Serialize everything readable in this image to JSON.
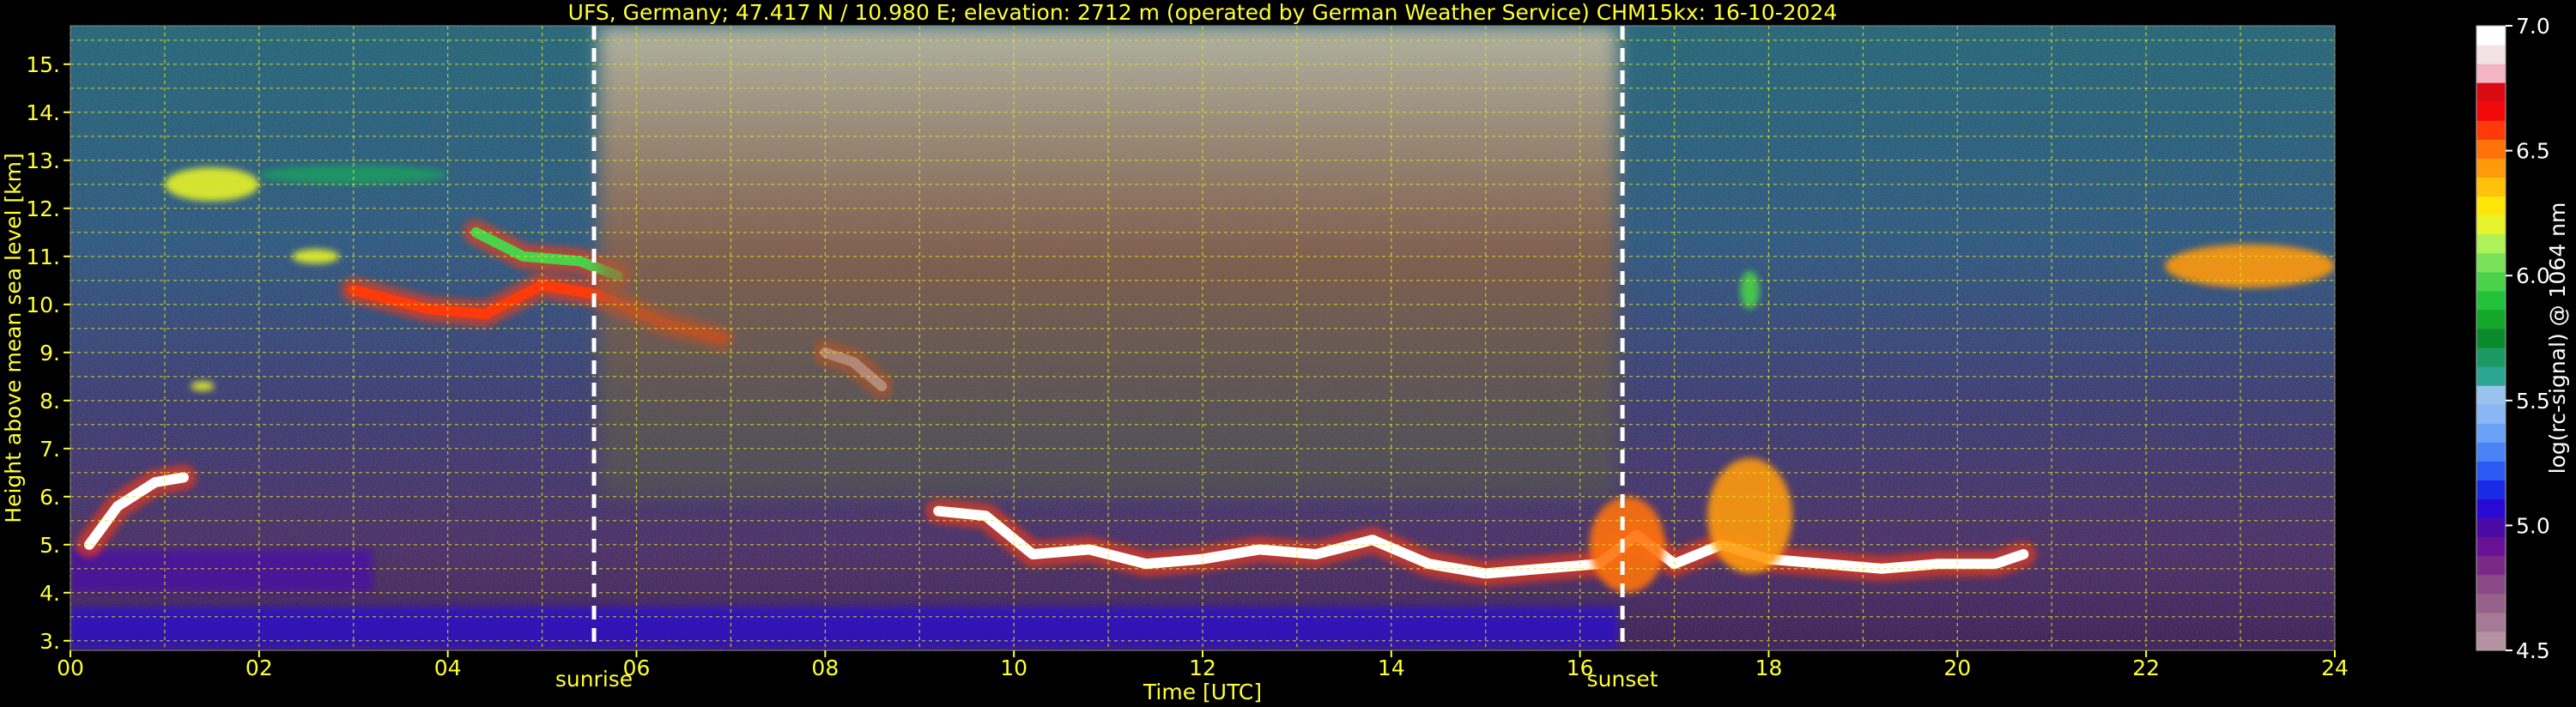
{
  "chart_data": {
    "type": "heatmap",
    "title": "UFS, Germany; 47.417 N / 10.980 E; elevation: 2712 m  (operated by German Weather Service)     CHM15kx: 16-10-2024",
    "xlabel": "Time [UTC]",
    "ylabel": "Height above mean sea level [km]",
    "xlim": [
      0,
      24
    ],
    "ylim": [
      2.8,
      15.8
    ],
    "x_ticks": [
      {
        "v": 0,
        "label": "00"
      },
      {
        "v": 2,
        "label": "02"
      },
      {
        "v": 4,
        "label": "04"
      },
      {
        "v": 6,
        "label": "06"
      },
      {
        "v": 8,
        "label": "08"
      },
      {
        "v": 10,
        "label": "10"
      },
      {
        "v": 12,
        "label": "12"
      },
      {
        "v": 14,
        "label": "14"
      },
      {
        "v": 16,
        "label": "16"
      },
      {
        "v": 18,
        "label": "18"
      },
      {
        "v": 20,
        "label": "20"
      },
      {
        "v": 22,
        "label": "22"
      },
      {
        "v": 24,
        "label": "24"
      }
    ],
    "y_ticks": [
      {
        "v": 3,
        "label": "3."
      },
      {
        "v": 4,
        "label": "4."
      },
      {
        "v": 5,
        "label": "5."
      },
      {
        "v": 6,
        "label": "6."
      },
      {
        "v": 7,
        "label": "7."
      },
      {
        "v": 8,
        "label": "8."
      },
      {
        "v": 9,
        "label": "9."
      },
      {
        "v": 10,
        "label": "10."
      },
      {
        "v": 11,
        "label": "11."
      },
      {
        "v": 12,
        "label": "12."
      },
      {
        "v": 13,
        "label": "13."
      },
      {
        "v": 14,
        "label": "14."
      },
      {
        "v": 15,
        "label": "15."
      }
    ],
    "x_minor_step": 1,
    "y_minor_step": 0.5,
    "grid": true,
    "events": [
      {
        "name": "sunrise",
        "x": 5.55
      },
      {
        "name": "sunset",
        "x": 16.45
      }
    ],
    "colorbar": {
      "label": "log(rc-signal) @ 1064 nm",
      "min": 4.5,
      "max": 7.0,
      "ticks": [
        {
          "v": 4.5,
          "label": "4.5"
        },
        {
          "v": 5.0,
          "label": "5.0"
        },
        {
          "v": 5.5,
          "label": "5.5"
        },
        {
          "v": 6.0,
          "label": "6.0"
        },
        {
          "v": 6.5,
          "label": "6.5"
        },
        {
          "v": 7.0,
          "label": "7.0"
        }
      ],
      "colors": [
        "#b592a2",
        "#a67a96",
        "#96628a",
        "#8a4a86",
        "#7a2a86",
        "#6a1296",
        "#4a0aa6",
        "#2a0ad2",
        "#1a2ae6",
        "#2a5af2",
        "#4a82f6",
        "#6aa2f6",
        "#8ab6f6",
        "#9ac2ee",
        "#2aa692",
        "#1a9a62",
        "#0a8a2a",
        "#12a62a",
        "#22c23a",
        "#4ad24a",
        "#7ae25a",
        "#aef25a",
        "#e6f22a",
        "#ffe60a",
        "#ffc20a",
        "#ff9a0a",
        "#ff720a",
        "#ff3a0a",
        "#f20a0a",
        "#da0a12",
        "#f2b6c2",
        "#f2e2e6",
        "#ffffff"
      ]
    },
    "features": [
      {
        "name": "boundary-layer-aerosol",
        "kind": "band",
        "x0": 0,
        "x1": 16.4,
        "y0": 2.85,
        "y1": 3.7,
        "value": 5.1
      },
      {
        "name": "pbl-upper-layer",
        "kind": "band",
        "x0": 0,
        "x1": 3.2,
        "y0": 4.0,
        "y1": 4.9,
        "value": 5.0
      },
      {
        "name": "morning-cloud-base",
        "kind": "line",
        "value": 7.0,
        "points": [
          [
            0.2,
            5.0
          ],
          [
            0.5,
            5.8
          ],
          [
            0.9,
            6.3
          ],
          [
            1.2,
            6.4
          ]
        ]
      },
      {
        "name": "cirrus-upper",
        "kind": "blob",
        "x": 1.5,
        "y": 12.5,
        "w": 1.0,
        "h": 0.7,
        "value": 6.2
      },
      {
        "name": "cirrus-upper-tail",
        "kind": "blob",
        "x": 3.0,
        "y": 12.7,
        "w": 2.0,
        "h": 0.4,
        "value": 5.7
      },
      {
        "name": "cirrus-mid",
        "kind": "blob",
        "x": 2.6,
        "y": 11.0,
        "w": 0.5,
        "h": 0.3,
        "value": 6.2
      },
      {
        "name": "cirrus-band-morning",
        "kind": "line",
        "value": 6.6,
        "points": [
          [
            3.0,
            10.3
          ],
          [
            3.8,
            9.9
          ],
          [
            4.4,
            9.8
          ],
          [
            5.0,
            10.4
          ],
          [
            5.6,
            10.2
          ],
          [
            6.3,
            9.6
          ],
          [
            6.9,
            9.3
          ]
        ]
      },
      {
        "name": "cirrus-band-morning-top",
        "kind": "line",
        "value": 6.0,
        "points": [
          [
            4.3,
            11.5
          ],
          [
            4.8,
            11.0
          ],
          [
            5.4,
            10.9
          ],
          [
            5.8,
            10.6
          ]
        ]
      },
      {
        "name": "cirrus-speck",
        "kind": "blob",
        "x": 1.4,
        "y": 8.3,
        "w": 0.25,
        "h": 0.2,
        "value": 6.2
      },
      {
        "name": "cirrus-fall",
        "kind": "line",
        "value": 6.8,
        "points": [
          [
            8.0,
            9.0
          ],
          [
            8.3,
            8.8
          ],
          [
            8.6,
            8.3
          ]
        ]
      },
      {
        "name": "cloud-base-day",
        "kind": "line",
        "value": 7.0,
        "points": [
          [
            9.2,
            5.7
          ],
          [
            9.7,
            5.6
          ],
          [
            10.2,
            4.8
          ],
          [
            10.8,
            4.9
          ],
          [
            11.4,
            4.6
          ],
          [
            12.0,
            4.7
          ],
          [
            12.6,
            4.9
          ],
          [
            13.2,
            4.8
          ],
          [
            13.8,
            5.1
          ],
          [
            14.4,
            4.6
          ],
          [
            15.0,
            4.4
          ],
          [
            15.6,
            4.5
          ],
          [
            16.2,
            4.6
          ],
          [
            16.6,
            5.2
          ],
          [
            17.0,
            4.6
          ],
          [
            17.5,
            5.0
          ],
          [
            18.0,
            4.7
          ],
          [
            18.6,
            4.6
          ],
          [
            19.2,
            4.5
          ],
          [
            19.8,
            4.6
          ],
          [
            20.4,
            4.6
          ],
          [
            20.7,
            4.8
          ]
        ]
      },
      {
        "name": "convective-cloud-evening",
        "kind": "blob",
        "x": 16.5,
        "y": 5.0,
        "w": 0.8,
        "h": 2.0,
        "value": 6.5
      },
      {
        "name": "convective-cloud-18",
        "kind": "blob",
        "x": 17.8,
        "y": 5.6,
        "w": 0.9,
        "h": 2.4,
        "value": 6.4
      },
      {
        "name": "virga-18",
        "kind": "blob",
        "x": 17.8,
        "y": 10.3,
        "w": 0.2,
        "h": 0.8,
        "value": 6.0
      },
      {
        "name": "cirrus-evening",
        "kind": "blob",
        "x": 23.1,
        "y": 10.8,
        "w": 1.8,
        "h": 0.9,
        "value": 6.4
      },
      {
        "name": "lidar-noise-daytime",
        "kind": "band",
        "x0": 5.6,
        "x1": 16.4,
        "y0": 6.0,
        "y1": 15.8,
        "value": 5.8
      }
    ]
  }
}
